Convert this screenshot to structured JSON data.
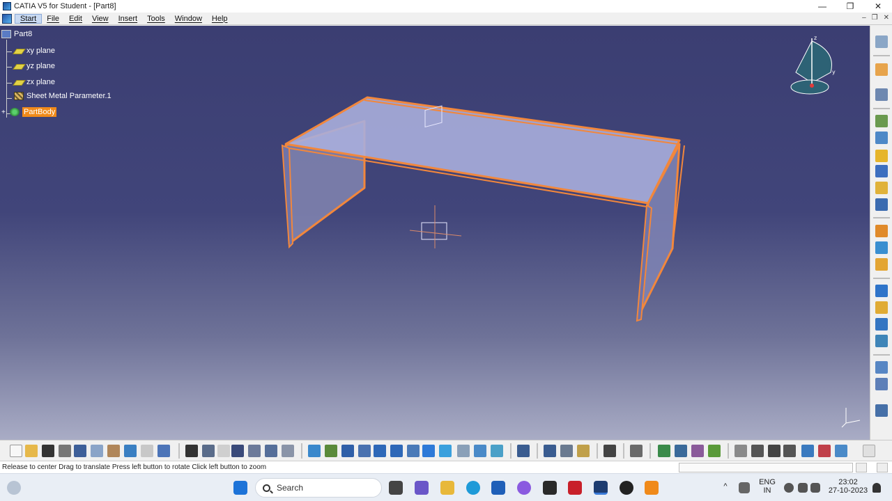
{
  "window": {
    "title": "CATIA V5 for Student - [Part8]",
    "controls": [
      "—",
      "❐",
      "✕"
    ]
  },
  "menubar": {
    "items": [
      "Start",
      "File",
      "Edit",
      "View",
      "Insert",
      "Tools",
      "Window",
      "Help"
    ],
    "right_controls": [
      "–",
      "❐",
      "✕"
    ]
  },
  "tree": {
    "root": "Part8",
    "items": [
      {
        "label": "xy plane",
        "icon": "plane-icon"
      },
      {
        "label": "yz plane",
        "icon": "plane-icon"
      },
      {
        "label": "zx plane",
        "icon": "plane-icon"
      },
      {
        "label": "Sheet Metal Parameter.1",
        "icon": "sheet-metal-parameter-icon"
      },
      {
        "label": "PartBody",
        "icon": "part-body-icon",
        "selected": true
      }
    ]
  },
  "compass": {
    "axes": [
      "z",
      "y"
    ]
  },
  "statusbar": {
    "text": "Release to center  Drag to translate  Press left button to rotate  Click left button to zoom"
  },
  "taskbar": {
    "search_placeholder": "Search",
    "language": "ENG",
    "region": "IN",
    "time": "23:02",
    "date": "27-10-2023"
  },
  "colors": {
    "viewport_top": "#3b3e72",
    "viewport_bottom": "#a9acc5",
    "selection": "#f08a1a",
    "highlight_edge": "#f2873c"
  }
}
